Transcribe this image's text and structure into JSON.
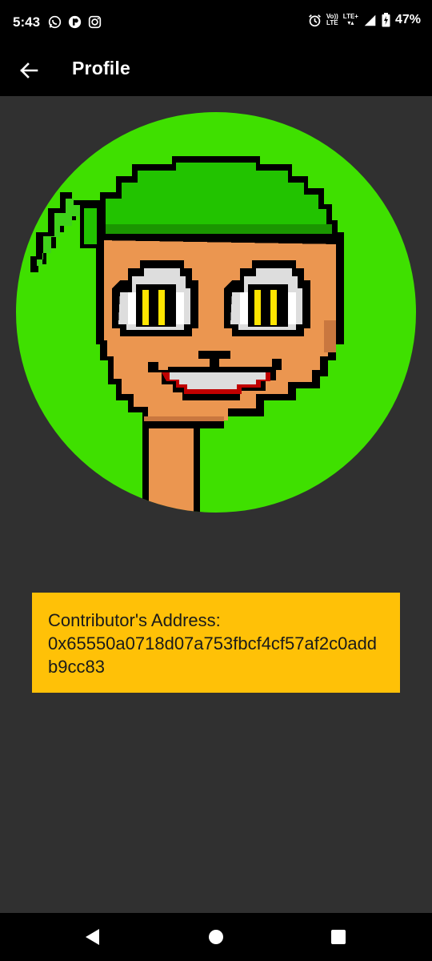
{
  "status_bar": {
    "time": "5:43",
    "network_vo": "Vo))",
    "network_lte": "LTE",
    "network_lte_plus": "LTE+",
    "battery": "47%",
    "left_icons": [
      "whatsapp-icon",
      "notification-app-icon",
      "instagram-icon"
    ],
    "right_icons": [
      "alarm-icon",
      "volte-icon",
      "lte-icon",
      "signal-icon",
      "battery-charging-icon"
    ]
  },
  "app_bar": {
    "title": "Profile",
    "back_icon": "arrow-back-icon"
  },
  "profile": {
    "avatar_description_icon": "pixel-avatar",
    "colors": {
      "avatar_background": "#3FE000",
      "skin": "#EB9650",
      "bandana": "#22C300",
      "card": "#FFC107",
      "content_background": "#303030"
    },
    "address_label": "Contributor's Address:",
    "address_value": "0x65550a0718d07a753fbcf4cf57af2c0addb9cc83"
  },
  "nav_bar": {
    "icons": [
      "back-triangle-icon",
      "home-circle-icon",
      "recents-square-icon"
    ]
  }
}
